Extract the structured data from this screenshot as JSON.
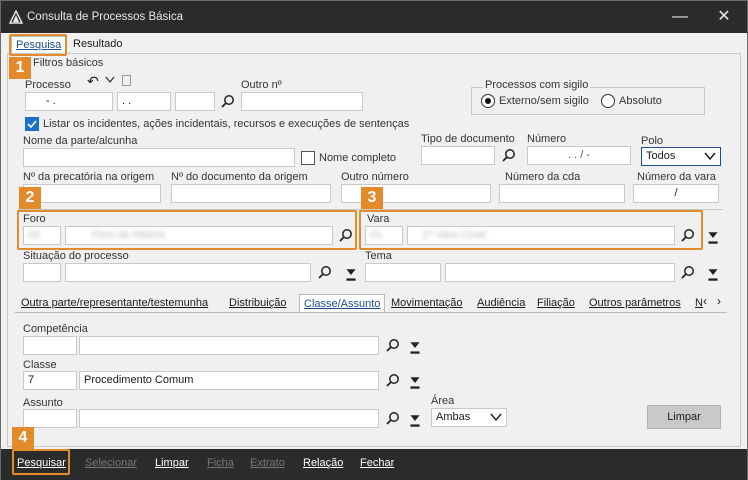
{
  "window": {
    "title": "Consulta de Processos Básica"
  },
  "tabs": [
    "Pesquisa",
    "Resultado"
  ],
  "filters": {
    "section_title": "Filtros básicos",
    "processo_label": "Processo",
    "processo_parts": [
      "- .",
      ". .",
      ""
    ],
    "outro_n_label": "Outro nº",
    "sigilo": {
      "title": "Processos com sigilo",
      "options": [
        "Externo/sem sigilo",
        "Absoluto"
      ],
      "selected": "Externo/sem sigilo"
    },
    "listar_label": "Listar os incidentes, ações incidentais, recursos e execuções de sentenças",
    "nome_parte_label": "Nome da parte/alcunha",
    "nome_completo_label": "Nome completo",
    "tipo_documento_label": "Tipo de documento",
    "numero_label": "Número",
    "numero_value": ". . /  -",
    "polo_label": "Polo",
    "polo_value": "Todos",
    "precatoria_label": "Nº da precatória na origem",
    "documento_origem_label": "Nº do documento da origem",
    "outro_numero_label": "Outro número",
    "numero_cda_label": "Número da cda",
    "numero_vara_label": "Número da vara",
    "numero_vara_value": "/",
    "foro_label": "Foro",
    "foro_code": "00",
    "foro_name": "Foro de Niterói",
    "vara_label": "Vara",
    "vara_code": "01",
    "vara_name": "1ª Vara Cível",
    "situacao_label": "Situação do processo",
    "tema_label": "Tema"
  },
  "subtabs": [
    "Outra parte/representante/testemunha",
    "Distribuição",
    "Classe/Assunto",
    "Movimentação",
    "Audiência",
    "Filiação",
    "Outros parâmetros",
    "N"
  ],
  "active_subtab": "Classe/Assunto",
  "classe_assunto": {
    "competencia_label": "Competência",
    "classe_label": "Classe",
    "classe_code": "7",
    "classe_name": "Procedimento Comum",
    "assunto_label": "Assunto",
    "area_label": "Área",
    "area_value": "Ambas",
    "limpar_button": "Limpar"
  },
  "footer": {
    "buttons": [
      "Pesquisar",
      "Selecionar",
      "Limpar",
      "Ficha",
      "Extrato",
      "Relação",
      "Fechar"
    ],
    "disabled": [
      "Selecionar",
      "Ficha",
      "Extrato"
    ]
  },
  "annotations": [
    "1",
    "2",
    "3",
    "4"
  ],
  "colors": {
    "accent_orange": "#e38b2b",
    "titlebar": "#2b2b2b",
    "link_blue": "#1b4f8c",
    "checkbox_blue": "#1b73c9"
  }
}
